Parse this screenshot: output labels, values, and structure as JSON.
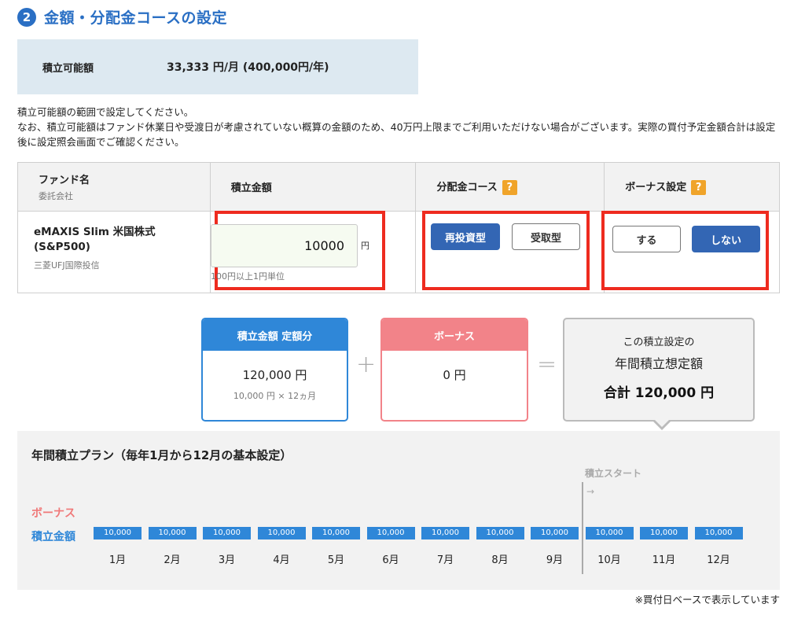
{
  "section": {
    "step": "2",
    "title": "金額・分配金コースの設定"
  },
  "limit": {
    "label": "積立可能額",
    "value": "33,333 円/月 (400,000円/年)"
  },
  "notes": {
    "line1": "積立可能額の範囲で設定してください。",
    "line2": "なお、積立可能額はファンド休業日や受渡日が考慮されていない概算の金額のため、40万円上限までご利用いただけない場合がございます。実際の買付予定金額合計は設定後に設定照会画面でご確認ください。"
  },
  "table": {
    "headers": {
      "fund": "ファンド名",
      "fund_sub": "委託会社",
      "amount": "積立金額",
      "course": "分配金コース",
      "bonus": "ボーナス設定",
      "help": "?"
    },
    "row": {
      "fund_name": "eMAXIS Slim 米国株式 (S&P500)",
      "company": "三菱UFJ国際投信",
      "amount_value": "10000",
      "amount_unit": "円",
      "amount_hint": "100円以上1円単位",
      "course_options": [
        "再投資型",
        "受取型"
      ],
      "course_selected": "再投資型",
      "bonus_options": [
        "する",
        "しない"
      ],
      "bonus_selected": "しない"
    }
  },
  "summary": {
    "fixed": {
      "label": "積立金額 定額分",
      "value": "120,000 円",
      "sub": "10,000 円 × 12ヵ月"
    },
    "plus": "+",
    "bonus": {
      "label": "ボーナス",
      "value": "0 円"
    },
    "equals": "=",
    "total": {
      "line1": "この積立設定の",
      "line2": "年間積立想定額",
      "line3": "合計  120,000 円"
    }
  },
  "plan": {
    "title": "年間積立プラン（毎年1月から12月の基本設定）",
    "start_label": "積立スタート",
    "start_arrow": "→",
    "bonus_label": "ボーナス",
    "amount_label": "積立金額",
    "months": [
      "1月",
      "2月",
      "3月",
      "4月",
      "5月",
      "6月",
      "7月",
      "8月",
      "9月",
      "10月",
      "11月",
      "12月"
    ],
    "monthly_values": [
      "10,000",
      "10,000",
      "10,000",
      "10,000",
      "10,000",
      "10,000",
      "10,000",
      "10,000",
      "10,000",
      "10,000",
      "10,000",
      "10,000"
    ]
  },
  "footnote": "※買付日ベースで表示しています",
  "colors": {
    "primary_blue": "#2a6fc4",
    "selected_button": "#3366b4",
    "summary_fixed": "#2f87d8",
    "summary_bonus": "#f28389",
    "highlight_red": "#ee2b1f",
    "help_orange": "#f0a42a"
  }
}
